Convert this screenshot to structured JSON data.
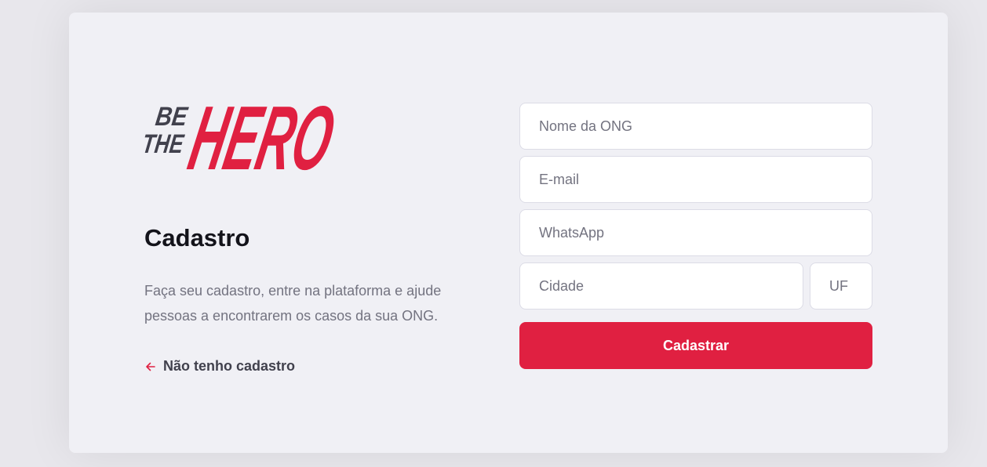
{
  "logo": {
    "line1": "BE",
    "line2": "THE",
    "word": "HERO",
    "dark_color": "#41414d",
    "brand_color": "#e02041"
  },
  "page": {
    "title": "Cadastro",
    "description": "Faça seu cadastro, entre na plataforma e ajude pessoas a encontrarem os casos da sua ONG."
  },
  "back_link": {
    "icon": "arrow-left-icon",
    "label": "Não tenho cadastro"
  },
  "form": {
    "name_placeholder": "Nome da ONG",
    "email_placeholder": "E-mail",
    "whatsapp_placeholder": "WhatsApp",
    "city_placeholder": "Cidade",
    "uf_placeholder": "UF",
    "submit_label": "Cadastrar"
  }
}
